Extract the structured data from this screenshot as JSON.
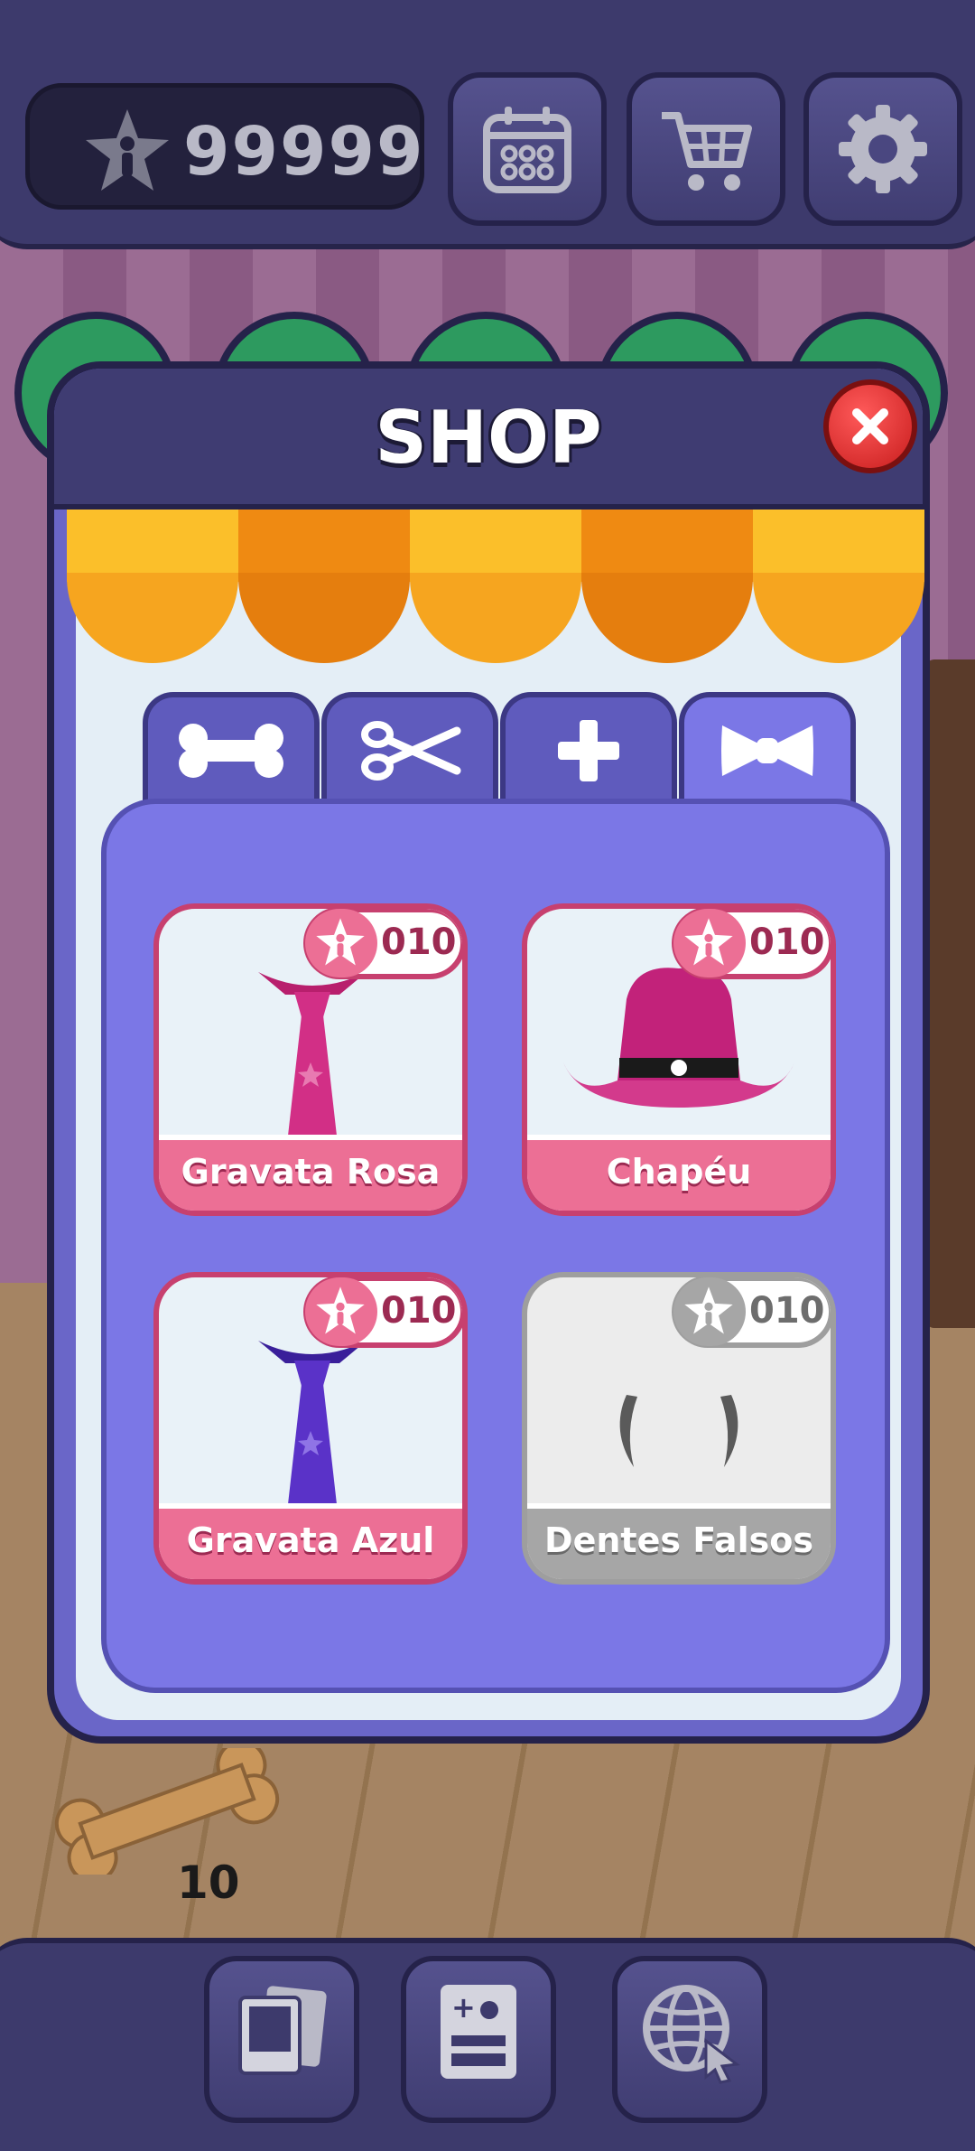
{
  "header": {
    "currency_value": "99999",
    "buttons": [
      {
        "name": "calendar",
        "icon": "calendar-icon"
      },
      {
        "name": "shop",
        "icon": "shopping-cart-icon"
      },
      {
        "name": "settings",
        "icon": "gear-icon"
      }
    ]
  },
  "shop": {
    "title": "SHOP",
    "tabs": [
      {
        "name": "food",
        "icon": "bone-icon",
        "active": false
      },
      {
        "name": "grooming",
        "icon": "scissors-icon",
        "active": false
      },
      {
        "name": "health",
        "icon": "plus-icon",
        "active": false
      },
      {
        "name": "accessories",
        "icon": "bow-tie-icon",
        "active": true
      }
    ],
    "items": [
      {
        "label": "Gravata Rosa",
        "price": "010",
        "icon": "pink-tie-icon",
        "available": true
      },
      {
        "label": "Chapéu",
        "price": "010",
        "icon": "cowboy-hat-icon",
        "available": true
      },
      {
        "label": "Gravata Azul",
        "price": "010",
        "icon": "blue-tie-icon",
        "available": true
      },
      {
        "label": "Dentes Falsos",
        "price": "010",
        "icon": "fangs-icon",
        "available": false
      }
    ]
  },
  "inventory": {
    "bones_count": "10"
  },
  "footer": {
    "buttons": [
      {
        "name": "photos",
        "icon": "photos-icon"
      },
      {
        "name": "pet-card",
        "icon": "pet-card-icon"
      },
      {
        "name": "online",
        "icon": "globe-icon"
      }
    ]
  },
  "colors": {
    "panel": "#6a66c8",
    "accent_pink": "#ec6f95",
    "dark_frame": "#25224a"
  }
}
